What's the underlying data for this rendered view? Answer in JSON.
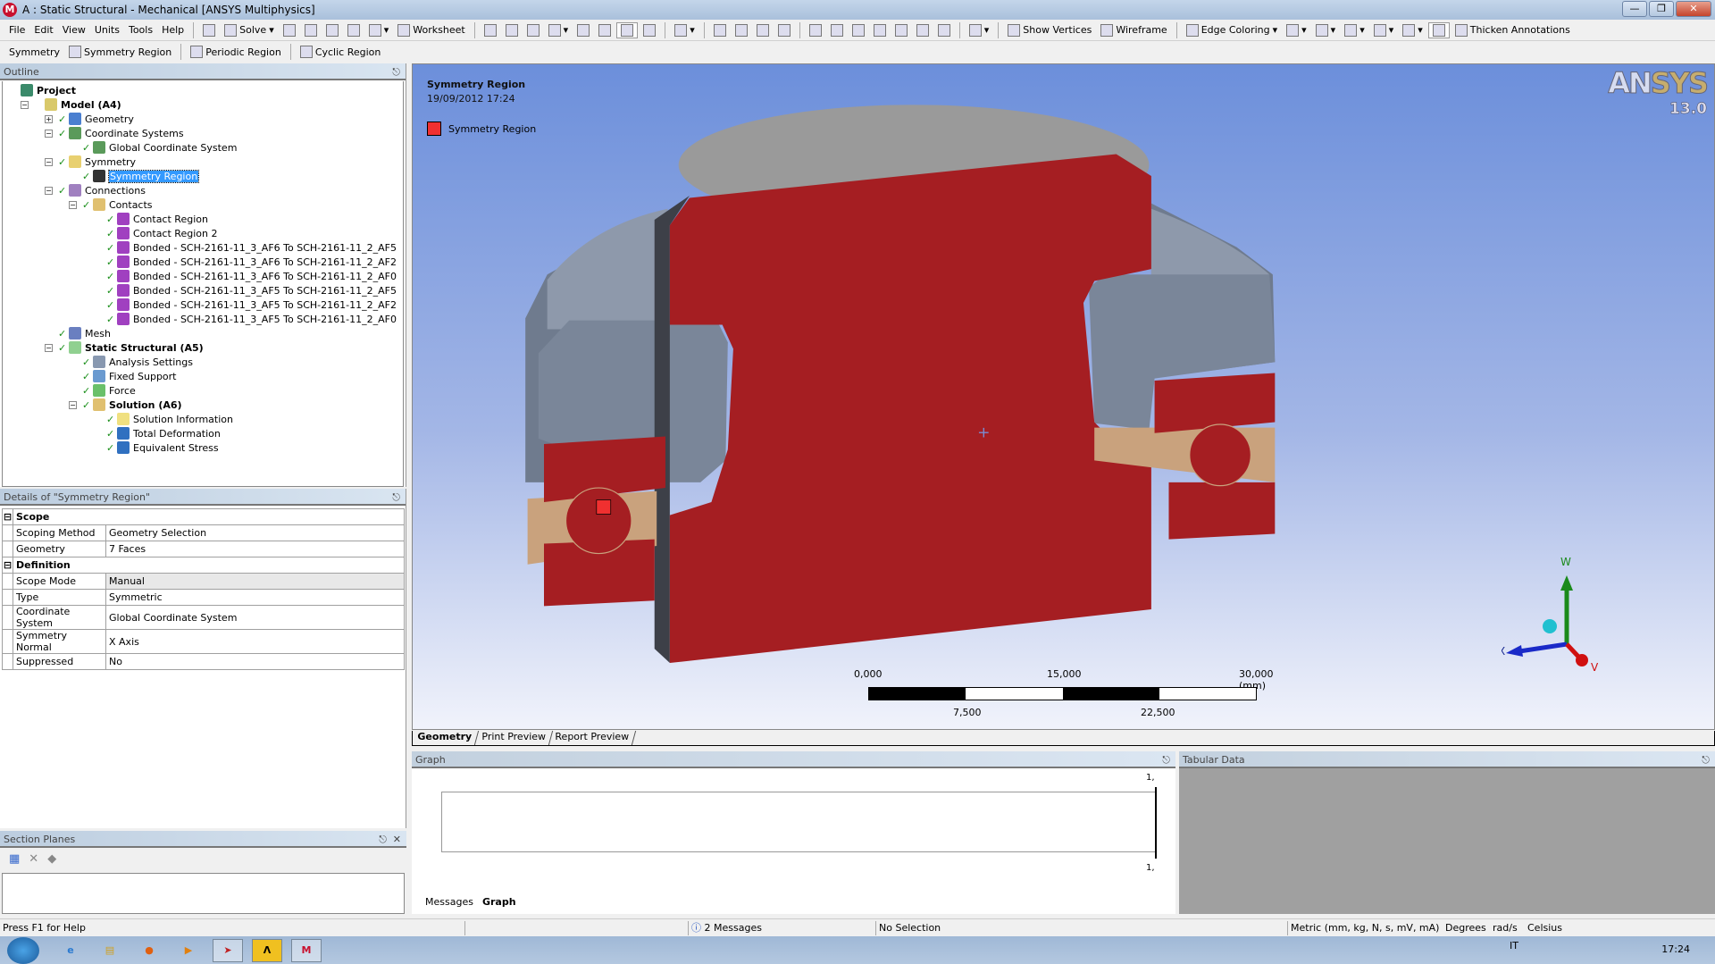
{
  "window": {
    "title": "A : Static Structural - Mechanical [ANSYS Multiphysics]",
    "app_icon": "M"
  },
  "toolbar1": [
    {
      "label": "File"
    },
    {
      "label": "Edit"
    },
    {
      "label": "View"
    },
    {
      "label": "Units"
    },
    {
      "label": "Tools"
    },
    {
      "label": "Help"
    },
    {
      "sep": true
    },
    {
      "icon": "check-icon"
    },
    {
      "icon": "solve-icon",
      "label": "Solve",
      "dropdown": true
    },
    {
      "icon": "new-section-icon"
    },
    {
      "icon": "comment-icon"
    },
    {
      "icon": "chart-icon"
    },
    {
      "icon": "text-icon"
    },
    {
      "icon": "image-icon",
      "dropdown": true
    },
    {
      "icon": "worksheet-icon",
      "label": "Worksheet"
    },
    {
      "sep": true
    },
    {
      "icon": "probe-icon"
    },
    {
      "icon": "label-icon"
    },
    {
      "icon": "coordinates-icon"
    },
    {
      "icon": "select-mode-icon",
      "dropdown": true
    },
    {
      "icon": "select-vertex-icon"
    },
    {
      "icon": "select-edge-icon"
    },
    {
      "icon": "select-face-icon",
      "active": true
    },
    {
      "icon": "select-body-icon"
    },
    {
      "sep": true
    },
    {
      "icon": "extend-icon",
      "dropdown": true
    },
    {
      "sep": true
    },
    {
      "icon": "rotate-icon"
    },
    {
      "icon": "pan-icon"
    },
    {
      "icon": "zoom-icon"
    },
    {
      "icon": "zoom-box-icon"
    },
    {
      "sep": true
    },
    {
      "icon": "zoom-fit-icon"
    },
    {
      "icon": "box-zoom-icon"
    },
    {
      "icon": "zoom-in-icon"
    },
    {
      "icon": "zoom-out-icon"
    },
    {
      "icon": "iso-icon"
    },
    {
      "icon": "previous-view-icon"
    },
    {
      "icon": "next-view-icon"
    },
    {
      "sep": true
    },
    {
      "icon": "viewports-icon",
      "dropdown": true
    },
    {
      "sep": true
    },
    {
      "icon": "show-vertices-icon",
      "label": "Show Vertices"
    },
    {
      "icon": "wireframe-icon",
      "label": "Wireframe"
    },
    {
      "sep": true
    },
    {
      "icon": "edge-coloring-icon",
      "label": "Edge Coloring",
      "dropdown": true
    },
    {
      "icon": "edge-style-0-icon",
      "dropdown": true
    },
    {
      "icon": "edge-style-1-icon",
      "dropdown": true
    },
    {
      "icon": "edge-style-2-icon",
      "dropdown": true
    },
    {
      "icon": "edge-style-3-icon",
      "dropdown": true
    },
    {
      "icon": "edge-style-x-icon",
      "dropdown": true
    },
    {
      "icon": "thicken-toggle-icon",
      "active": true
    },
    {
      "icon": "thicken-annotations-icon",
      "label": "Thicken Annotations"
    }
  ],
  "toolbar2": [
    {
      "label": "Symmetry"
    },
    {
      "icon": "symmetry-region-icon",
      "label": "Symmetry Region"
    },
    {
      "sep": true
    },
    {
      "icon": "periodic-region-icon",
      "label": "Periodic Region"
    },
    {
      "sep": true
    },
    {
      "icon": "cyclic-region-icon",
      "label": "Cyclic Region"
    }
  ],
  "outline": {
    "title": "Outline",
    "items": [
      {
        "label": "Project",
        "level": 0,
        "bold": true,
        "icon": "project-icon",
        "color": "#3a8a6a"
      },
      {
        "label": "Model (A4)",
        "level": 1,
        "bold": true,
        "icon": "model-icon",
        "expand": "-",
        "color": "#d9c96a"
      },
      {
        "label": "Geometry",
        "level": 2,
        "icon": "geometry-icon",
        "expand": "+",
        "check": true,
        "color": "#4a7fd0"
      },
      {
        "label": "Coordinate Systems",
        "level": 2,
        "icon": "coordinate-systems-icon",
        "expand": "-",
        "check": true,
        "color": "#5a9a5a"
      },
      {
        "label": "Global Coordinate System",
        "level": 3,
        "icon": "coordinate-system-icon",
        "check": true,
        "color": "#5a9a5a"
      },
      {
        "label": "Symmetry",
        "level": 2,
        "icon": "symmetry-folder-icon",
        "expand": "-",
        "check": true,
        "color": "#e8d070"
      },
      {
        "label": "Symmetry Region",
        "level": 3,
        "icon": "symmetry-region-icon",
        "check": true,
        "selected": true,
        "color": "#333"
      },
      {
        "label": "Connections",
        "level": 2,
        "icon": "connections-icon",
        "expand": "-",
        "check": true,
        "color": "#a080c0"
      },
      {
        "label": "Contacts",
        "level": 3,
        "icon": "contacts-folder-icon",
        "expand": "-",
        "check": true,
        "color": "#e0c070"
      },
      {
        "label": "Contact Region",
        "level": 4,
        "icon": "contact-icon",
        "check": true,
        "color": "#a040c0"
      },
      {
        "label": "Contact Region 2",
        "level": 4,
        "icon": "contact-icon",
        "check": true,
        "color": "#a040c0"
      },
      {
        "label": "Bonded - SCH-2161-11_3_AF6 To SCH-2161-11_2_AF5",
        "level": 4,
        "icon": "contact-icon",
        "check": true,
        "color": "#a040c0"
      },
      {
        "label": "Bonded - SCH-2161-11_3_AF6 To SCH-2161-11_2_AF2",
        "level": 4,
        "icon": "contact-icon",
        "check": true,
        "color": "#a040c0"
      },
      {
        "label": "Bonded - SCH-2161-11_3_AF6 To SCH-2161-11_2_AF0",
        "level": 4,
        "icon": "contact-icon",
        "check": true,
        "color": "#a040c0"
      },
      {
        "label": "Bonded - SCH-2161-11_3_AF5 To SCH-2161-11_2_AF5",
        "level": 4,
        "icon": "contact-icon",
        "check": true,
        "color": "#a040c0"
      },
      {
        "label": "Bonded - SCH-2161-11_3_AF5 To SCH-2161-11_2_AF2",
        "level": 4,
        "icon": "contact-icon",
        "check": true,
        "color": "#a040c0"
      },
      {
        "label": "Bonded - SCH-2161-11_3_AF5 To SCH-2161-11_2_AF0",
        "level": 4,
        "icon": "contact-icon",
        "check": true,
        "color": "#a040c0"
      },
      {
        "label": "Mesh",
        "level": 2,
        "icon": "mesh-icon",
        "check": true,
        "color": "#6a7fc0"
      },
      {
        "label": "Static Structural (A5)",
        "level": 2,
        "bold": true,
        "icon": "static-structural-icon",
        "expand": "-",
        "check": true,
        "color": "#90d090"
      },
      {
        "label": "Analysis Settings",
        "level": 3,
        "icon": "analysis-settings-icon",
        "check": true,
        "color": "#8898b0"
      },
      {
        "label": "Fixed Support",
        "level": 3,
        "icon": "fixed-support-icon",
        "check": true,
        "color": "#6a9ad0"
      },
      {
        "label": "Force",
        "level": 3,
        "icon": "force-icon",
        "check": true,
        "color": "#6ac06a"
      },
      {
        "label": "Solution (A6)",
        "level": 3,
        "bold": true,
        "icon": "solution-icon",
        "expand": "-",
        "check": true,
        "color": "#e0c070"
      },
      {
        "label": "Solution Information",
        "level": 4,
        "icon": "solution-information-icon",
        "check": true,
        "color": "#f0e080"
      },
      {
        "label": "Total Deformation",
        "level": 4,
        "icon": "result-icon",
        "check": true,
        "color": "#3070c0"
      },
      {
        "label": "Equivalent Stress",
        "level": 4,
        "icon": "result-icon",
        "check": true,
        "color": "#3070c0"
      }
    ]
  },
  "details": {
    "title": "Details of \"Symmetry Region\"",
    "sections": [
      {
        "name": "Scope",
        "rows": [
          {
            "k": "Scoping Method",
            "v": "Geometry Selection"
          },
          {
            "k": "Geometry",
            "v": "7 Faces"
          }
        ]
      },
      {
        "name": "Definition",
        "rows": [
          {
            "k": "Scope Mode",
            "v": "Manual",
            "grey": true
          },
          {
            "k": "Type",
            "v": "Symmetric"
          },
          {
            "k": "Coordinate System",
            "v": "Global Coordinate System"
          },
          {
            "k": "Symmetry Normal",
            "v": "X Axis"
          },
          {
            "k": "Suppressed",
            "v": "No"
          }
        ]
      }
    ]
  },
  "section_planes": {
    "title": "Section Planes"
  },
  "viewport": {
    "title": "Symmetry Region",
    "date": "19/09/2012 17:24",
    "legend": "Symmetry Region",
    "legend_color": "#f03030",
    "logo_an": "AN",
    "logo_sys": "SYS",
    "version": "13.0",
    "scale": {
      "top": [
        "0,000",
        "15,000",
        "30,000 (mm)"
      ],
      "bottom": [
        "7,500",
        "22,500"
      ]
    },
    "triad": {
      "x": "X",
      "y": "V",
      "z": "W"
    }
  },
  "view_tabs": [
    "Geometry",
    "Print Preview",
    "Report Preview"
  ],
  "graph": {
    "title": "Graph",
    "y_top": "1,",
    "y_bottom": "1,",
    "tabs": [
      "Messages",
      "Graph"
    ]
  },
  "tabular": {
    "title": "Tabular Data"
  },
  "status": {
    "help": "Press F1 for Help",
    "messages": "2 Messages",
    "selection": "No Selection",
    "units": "Metric (mm, kg, N, s, mV, mA)",
    "angle": "Degrees",
    "rate": "rad/s",
    "temp": "Celsius"
  },
  "taskbar": {
    "lang": "IT",
    "time": "17:24"
  }
}
